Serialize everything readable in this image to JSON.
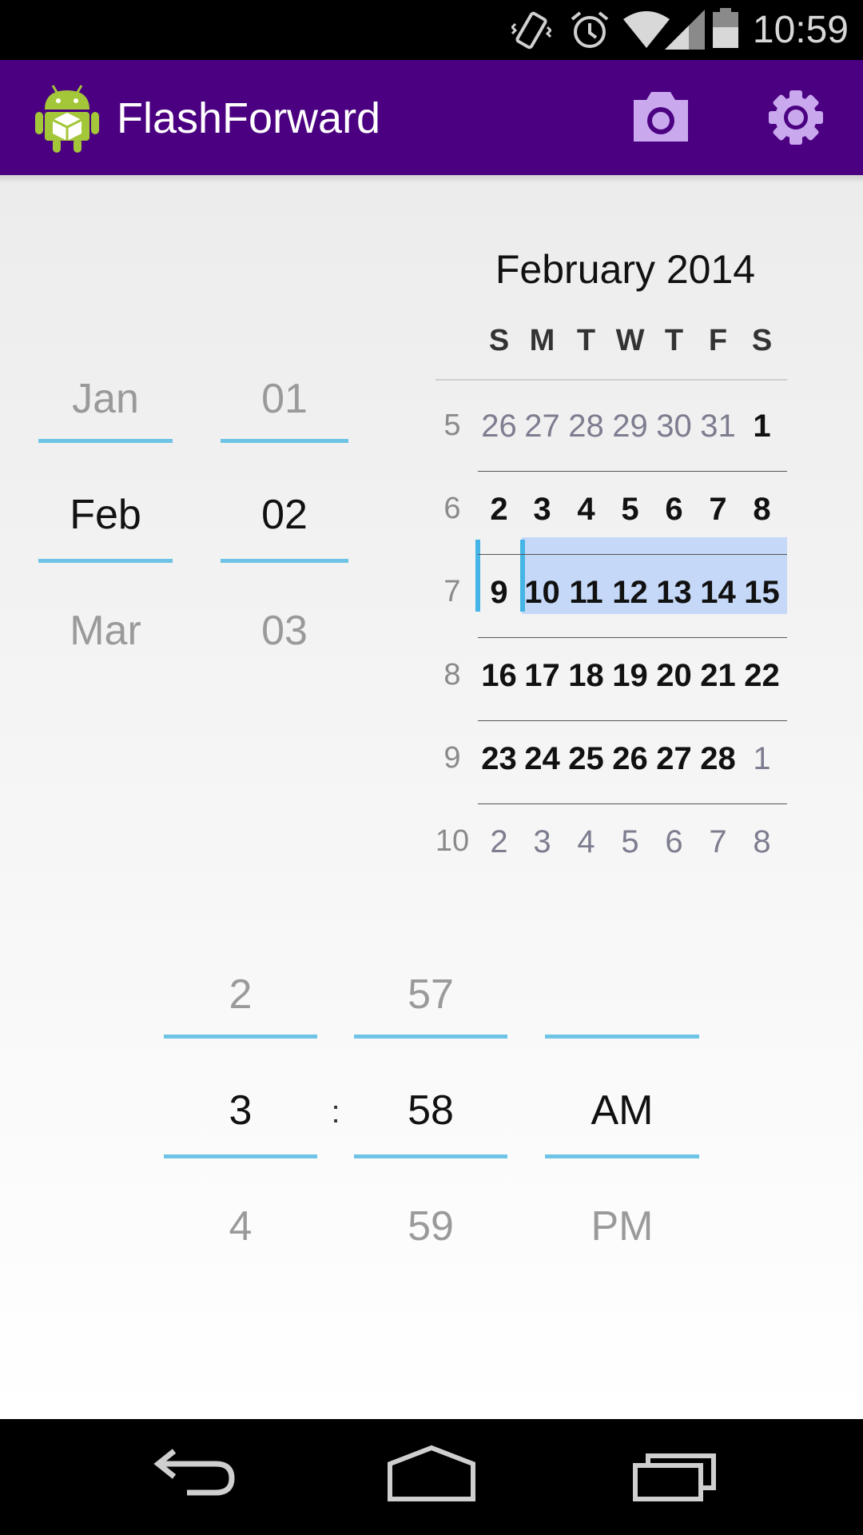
{
  "status_bar": {
    "time": "10:59"
  },
  "action_bar": {
    "title": "FlashForward",
    "background": "#4b0081",
    "actions": [
      {
        "icon": "camera-icon"
      },
      {
        "icon": "settings-icon"
      }
    ]
  },
  "date_picker": {
    "month": {
      "prev": "Jan",
      "current": "Feb",
      "next": "Mar"
    },
    "day": {
      "prev": "01",
      "current": "02",
      "next": "03"
    }
  },
  "calendar": {
    "title": "February 2014",
    "weekdays": [
      "S",
      "M",
      "T",
      "W",
      "T",
      "F",
      "S"
    ],
    "weeks": [
      {
        "num": "5",
        "days": [
          "26",
          "27",
          "28",
          "29",
          "30",
          "31",
          "1"
        ],
        "in_month": [
          false,
          false,
          false,
          false,
          false,
          false,
          true
        ]
      },
      {
        "num": "6",
        "days": [
          "2",
          "3",
          "4",
          "5",
          "6",
          "7",
          "8"
        ],
        "in_month": [
          true,
          true,
          true,
          true,
          true,
          true,
          true
        ]
      },
      {
        "num": "7",
        "days": [
          "9",
          "10",
          "11",
          "12",
          "13",
          "14",
          "15"
        ],
        "in_month": [
          true,
          true,
          true,
          true,
          true,
          true,
          true
        ]
      },
      {
        "num": "8",
        "days": [
          "16",
          "17",
          "18",
          "19",
          "20",
          "21",
          "22"
        ],
        "in_month": [
          true,
          true,
          true,
          true,
          true,
          true,
          true
        ]
      },
      {
        "num": "9",
        "days": [
          "23",
          "24",
          "25",
          "26",
          "27",
          "28",
          "1"
        ],
        "in_month": [
          true,
          true,
          true,
          true,
          true,
          true,
          false
        ]
      },
      {
        "num": "10",
        "days": [
          "2",
          "3",
          "4",
          "5",
          "6",
          "7",
          "8"
        ],
        "in_month": [
          false,
          false,
          false,
          false,
          false,
          false,
          false
        ]
      }
    ],
    "selected_day": "2",
    "selected_week": "6",
    "highlight_color": "#c5d8f7"
  },
  "time_picker": {
    "hour": {
      "prev": "2",
      "current": "3",
      "next": "4"
    },
    "separator": ":",
    "minute": {
      "prev": "57",
      "current": "58",
      "next": "59"
    },
    "ampm": {
      "prev": "",
      "current": "AM",
      "next": "PM"
    },
    "accent": "#6ec4e6"
  },
  "nav_bar": {
    "buttons": [
      {
        "icon": "back-icon"
      },
      {
        "icon": "home-icon"
      },
      {
        "icon": "recent-apps-icon"
      }
    ]
  }
}
